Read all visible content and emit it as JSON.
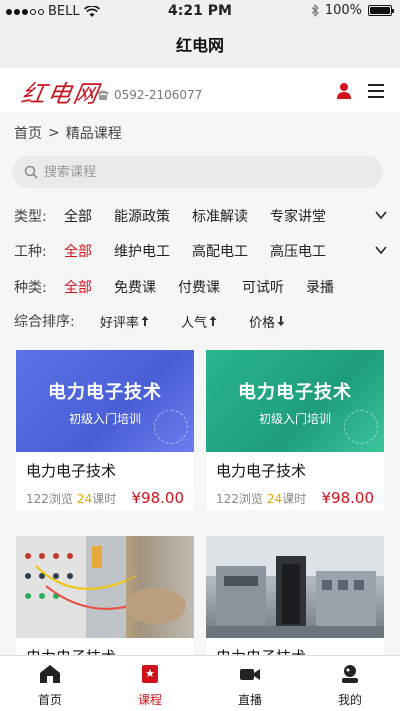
{
  "status": {
    "carrier": "BELL",
    "time": "4:21 PM",
    "battery": "100%"
  },
  "nav": {
    "title": "红电网"
  },
  "header": {
    "logo": "红电网",
    "phone": "0592-2106077"
  },
  "breadcrumb": {
    "home": "首页",
    "sep": ">",
    "current": "精品课程"
  },
  "search": {
    "placeholder": "搜索课程"
  },
  "filters": {
    "type": {
      "label": "类型:",
      "options": [
        "全部",
        "能源政策",
        "标准解读",
        "专家讲堂"
      ]
    },
    "work": {
      "label": "工种:",
      "options": [
        "全部",
        "维护电工",
        "高配电工",
        "高压电工"
      ]
    },
    "kind": {
      "label": "种类:",
      "options": [
        "全部",
        "免费课",
        "付费课",
        "可试听",
        "录播"
      ]
    }
  },
  "sort": {
    "label": "综合排序:",
    "items": [
      "好评率",
      "人气",
      "价格"
    ]
  },
  "cards": [
    {
      "banner_title": "电力电子技术",
      "banner_sub": "初级入门培训",
      "name": "电力电子技术",
      "views": "122浏览",
      "hours_num": "24",
      "hours_unit": "课时",
      "price": "¥98.00"
    },
    {
      "banner_title": "电力电子技术",
      "banner_sub": "初级入门培训",
      "name": "电力电子技术",
      "views": "122浏览",
      "hours_num": "24",
      "hours_unit": "课时",
      "price": "¥98.00"
    },
    {
      "name": "电力电子技术"
    },
    {
      "name": "电力电子技术"
    }
  ],
  "tabs": [
    "首页",
    "课程",
    "直播",
    "我的"
  ],
  "colors": {
    "accent": "#d0121b",
    "hours": "#e0a800"
  }
}
